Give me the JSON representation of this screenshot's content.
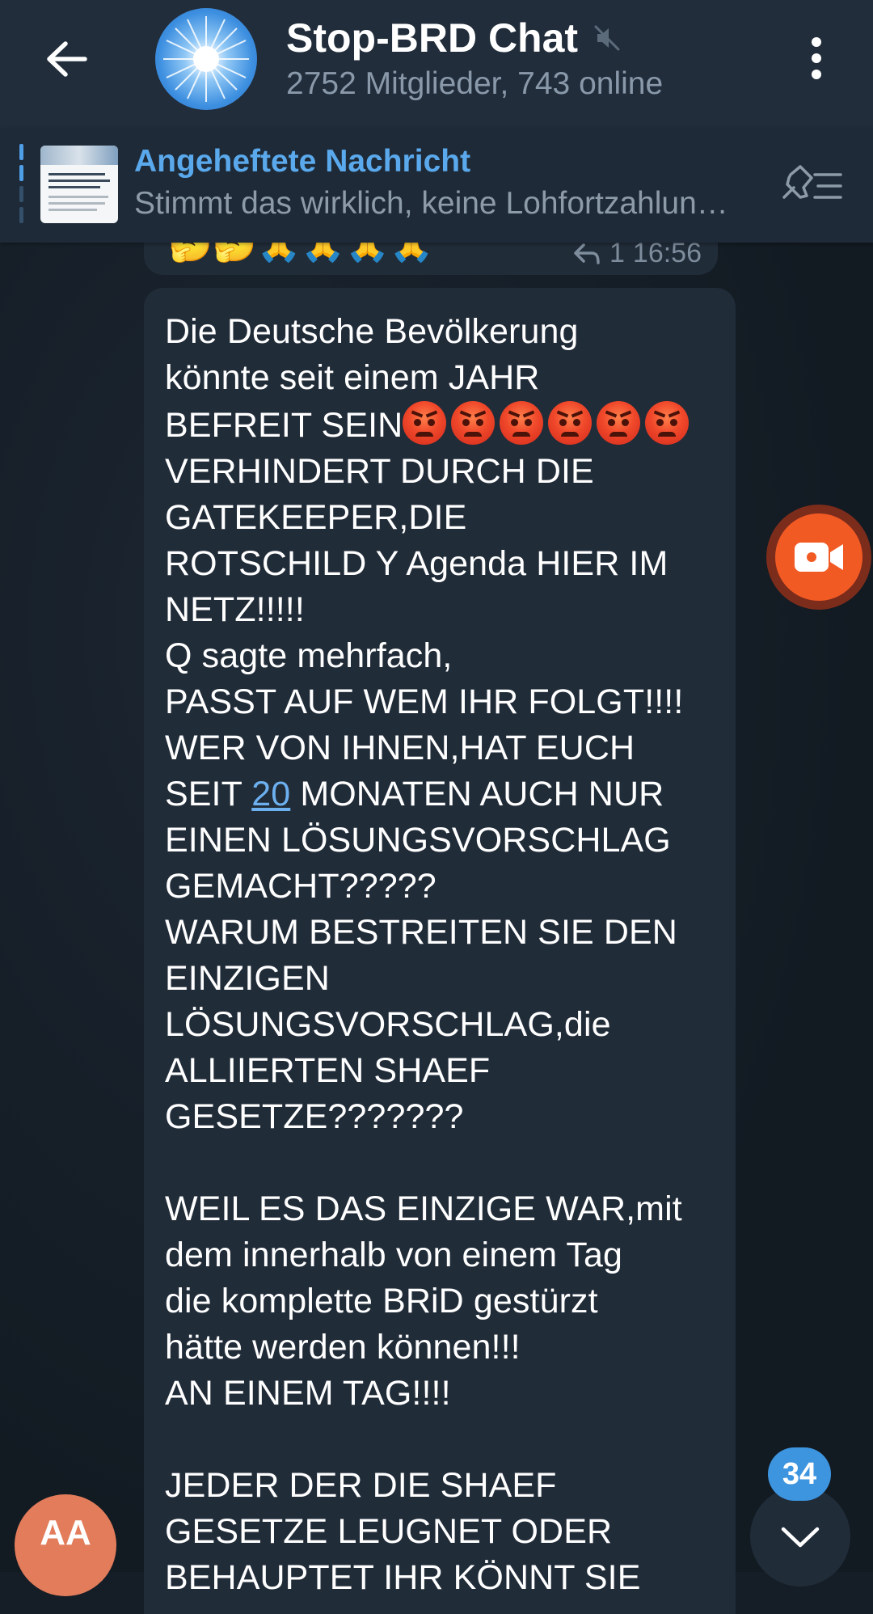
{
  "header": {
    "title": "Stop-BRD Chat",
    "subtitle": "2752 Mitglieder, 743 online",
    "icons": [
      "back-arrow-icon",
      "mute-icon",
      "more-vertical-icon"
    ]
  },
  "pinned": {
    "label": "Angeheftete Nachricht",
    "text": "Stimmt das wirklich, keine Lohfortzahlun…",
    "icons": [
      "pinned-list-icon"
    ]
  },
  "previous_message": {
    "emojis": "🤔🤔🙏🙏🙏🙏",
    "reply_count": "1",
    "time": "16:56"
  },
  "message": {
    "text_before_emoji": "Die Deutsche Bevölkerung\nkönnte seit einem JAHR\nBEFREIT SEIN",
    "angry_emoji_count": 6,
    "text_middle": "\nVERHINDERT DURCH DIE\nGATEKEEPER,DIE\nROTSCHILD Y Agenda HIER IM\nNETZ!!!!!\nQ sagte mehrfach,\nPASST AUF WEM IHR FOLGT!!!!\nWER VON IHNEN,HAT EUCH\nSEIT ",
    "link": "20",
    "text_after_link": " MONATEN AUCH NUR\nEINEN LÖSUNGSVORSCHLAG\nGEMACHT?????\nWARUM BESTREITEN SIE DEN\nEINZIGEN\nLÖSUNGSVORSCHLAG,die\nALLIIERTEN SHAEF\nGESETZE???????\n\nWEIL ES DAS EINZIGE WAR,mit\ndem innerhalb von einem Tag\ndie komplette BRiD gestürzt\nhätte werden können!!!\nAN EINEM TAG!!!!\n\nJEDER DER DIE SHAEF\nGESETZE LEUGNET ODER\nBEHAUPTET IHR KÖNNT SIE"
  },
  "floating": {
    "unread_count": "34",
    "user_initials": "AA",
    "icons": [
      "video-message-icon",
      "chevron-down-icon"
    ]
  },
  "colors": {
    "accent": "#5aa9ec",
    "header_bg": "#212d3b",
    "bubble_bg": "#212c39",
    "video_button": "#f25a24",
    "avatar_bg": "#e27c5a"
  }
}
